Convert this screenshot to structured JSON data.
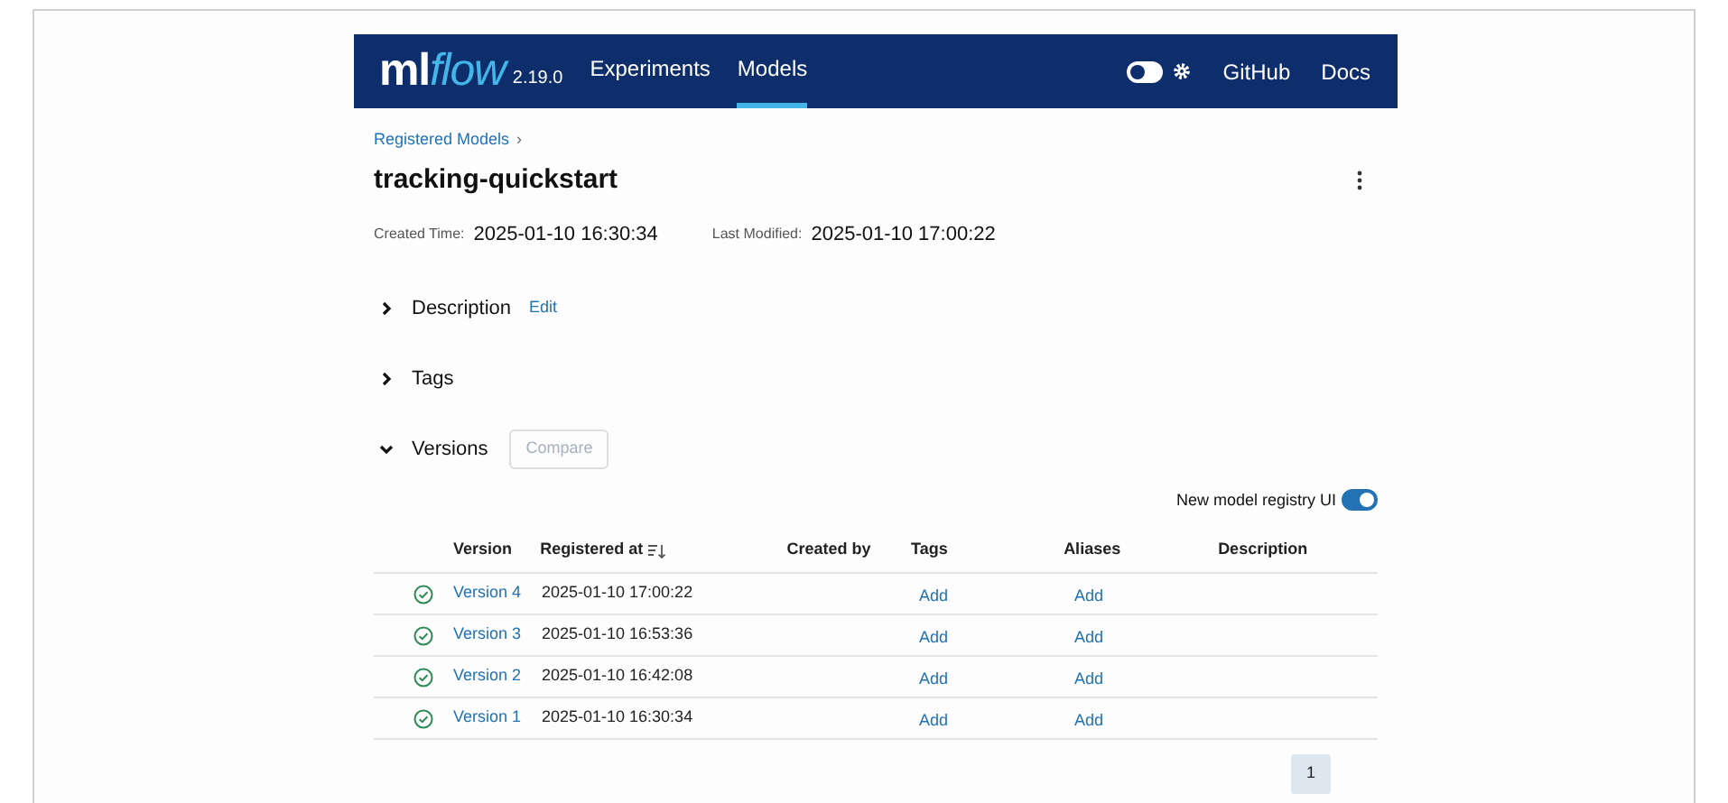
{
  "header": {
    "logo_main": "ml",
    "logo_accent": "flow",
    "version": "2.19.0",
    "nav": [
      {
        "label": "Experiments",
        "selected": false
      },
      {
        "label": "Models",
        "selected": true
      }
    ],
    "theme_toggle": {
      "on": false
    },
    "links": [
      "GitHub",
      "Docs"
    ]
  },
  "breadcrumb": {
    "link": "Registered Models",
    "separator": "›"
  },
  "title": "tracking-quickstart",
  "meta": [
    {
      "label": "Created Time:",
      "value": "2025-01-10 16:30:34"
    },
    {
      "label": "Last Modified:",
      "value": "2025-01-10 17:00:22"
    }
  ],
  "sections": [
    {
      "label": "Description",
      "expanded": false,
      "action": "Edit"
    },
    {
      "label": "Tags",
      "expanded": false
    },
    {
      "label": "Versions",
      "expanded": true,
      "button": {
        "label": "Compare",
        "disabled": true
      }
    }
  ],
  "registry_toggle": {
    "label": "New model registry UI",
    "on": true
  },
  "table": {
    "columns": [
      "Version",
      "Registered at",
      "Created by",
      "Tags",
      "Aliases",
      "Description"
    ],
    "rows": [
      {
        "version": "Version 4",
        "registered": "2025-01-10 17:00:22",
        "tags": "Add",
        "aliases": "Add"
      },
      {
        "version": "Version 3",
        "registered": "2025-01-10 16:53:36",
        "tags": "Add",
        "aliases": "Add"
      },
      {
        "version": "Version 2",
        "registered": "2025-01-10 16:42:08",
        "tags": "Add",
        "aliases": "Add"
      },
      {
        "version": "Version 1",
        "registered": "2025-01-10 16:30:34",
        "tags": "Add",
        "aliases": "Add"
      }
    ]
  },
  "pagination": [
    {
      "label": "1",
      "selected": true
    }
  ]
}
